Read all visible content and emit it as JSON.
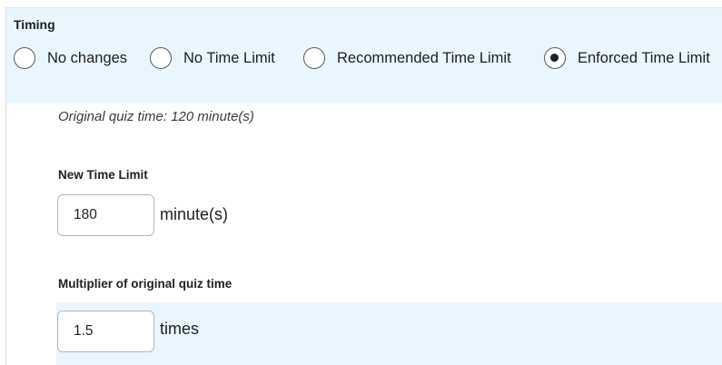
{
  "timing": {
    "title": "Timing",
    "options": [
      {
        "label": "No changes",
        "selected": false
      },
      {
        "label": "No Time Limit",
        "selected": false
      },
      {
        "label": "Recommended Time Limit",
        "selected": false
      },
      {
        "label": "Enforced Time Limit",
        "selected": true
      }
    ]
  },
  "original_time": "Original quiz time: 120 minute(s)",
  "new_time_limit": {
    "label": "New Time Limit",
    "value": "180",
    "unit": "minute(s)"
  },
  "multiplier": {
    "label": "Multiplier of original quiz time",
    "value": "1.5",
    "unit": "times"
  },
  "colors": {
    "panel_background": "#eaf6fd",
    "text": "#202122",
    "input_border": "#b3b6b8"
  }
}
